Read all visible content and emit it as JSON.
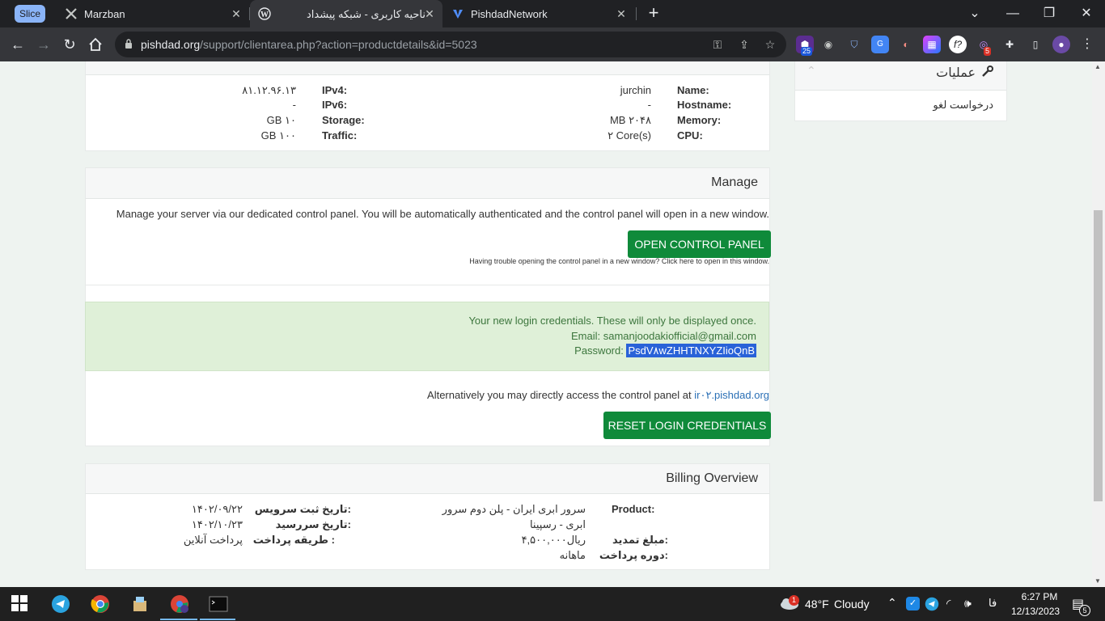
{
  "browser": {
    "tabs": [
      {
        "label": "Marzban",
        "icon": "marzban-icon"
      },
      {
        "label": "ناحیه کاربری - شبکه پیشداد",
        "icon": "wordpress-icon"
      },
      {
        "label": "PishdadNetwork",
        "icon": "vercel-icon"
      }
    ],
    "slice_label": "Slice",
    "new_tab": "+",
    "url_domain": "pishdad.org",
    "url_path": "/support/clientarea.php?action=productdetails&id=5023",
    "ext_badge_1": "25",
    "ext_badge_2": "5"
  },
  "sidebar": {
    "title": "عملیات",
    "item": "درخواست لغو"
  },
  "server_info": {
    "left": [
      {
        "label": "IPv4:",
        "value": "۸۱.۱۲.۹۶.۱۳"
      },
      {
        "label": "IPv6:",
        "value": "-"
      },
      {
        "label": "Storage:",
        "value": "GB ۱۰"
      },
      {
        "label": "Traffic:",
        "value": "GB ۱۰۰"
      }
    ],
    "right": [
      {
        "label": "Name:",
        "value": "jurchin"
      },
      {
        "label": "Hostname:",
        "value": "-"
      },
      {
        "label": "Memory:",
        "value": "MB ۲۰۴۸"
      },
      {
        "label": "CPU:",
        "value": "۲ Core(s)"
      }
    ]
  },
  "manage": {
    "title": "Manage",
    "description": "Manage your server via our dedicated control panel. You will be automatically authenticated and the control panel will open in a new window.",
    "open_button": "OPEN CONTROL PANEL",
    "trouble_text": "Having trouble opening the control panel in a new window? Click here to open in this window.",
    "credentials_intro": "Your new login credentials. These will only be displayed once.",
    "email_line": "Email: samanjoodakiofficial@gmail.com",
    "password_label": "Password:",
    "password_value": "PsdV۸wZHHTNXYZIioQnB",
    "alt_access_text": "Alternatively you may directly access the control panel at",
    "alt_access_link": "ir۰۲.pishdad.org",
    "reset_button": "RESET LOGIN CREDENTIALS"
  },
  "billing": {
    "title": "Billing Overview",
    "product_label": "Product:",
    "product_value_1": "سرور ابری ایران - پلن دوم سرور",
    "product_value_2": "ابری - رسپینا",
    "renewal_label": "مبلغ تمدید:",
    "renewal_value": "۴,۵۰۰,۰۰۰ریال",
    "period_label": "دوره پرداخت:",
    "period_value": "ماهانه",
    "reg_date_label": "تاریخ ثبت سرویس:",
    "reg_date_value": "۱۴۰۲/۰۹/۲۲",
    "due_date_label": "تاریخ سررسید:",
    "due_date_value": "۱۴۰۲/۱۰/۲۳",
    "payment_label": "طریقه پرداخت :",
    "payment_value": "پرداخت آنلاین"
  },
  "taskbar": {
    "weather_temp": "48°F",
    "weather_desc": "Cloudy",
    "weather_badge": "1",
    "lang": "فا",
    "time": "6:27 PM",
    "date": "12/13/2023",
    "notif_count": "5"
  },
  "colors": {
    "accent_green": "#0f8a3a",
    "success_bg": "#dff0d8",
    "selection_blue": "#2962d8",
    "link_blue": "#2a6fb5"
  }
}
